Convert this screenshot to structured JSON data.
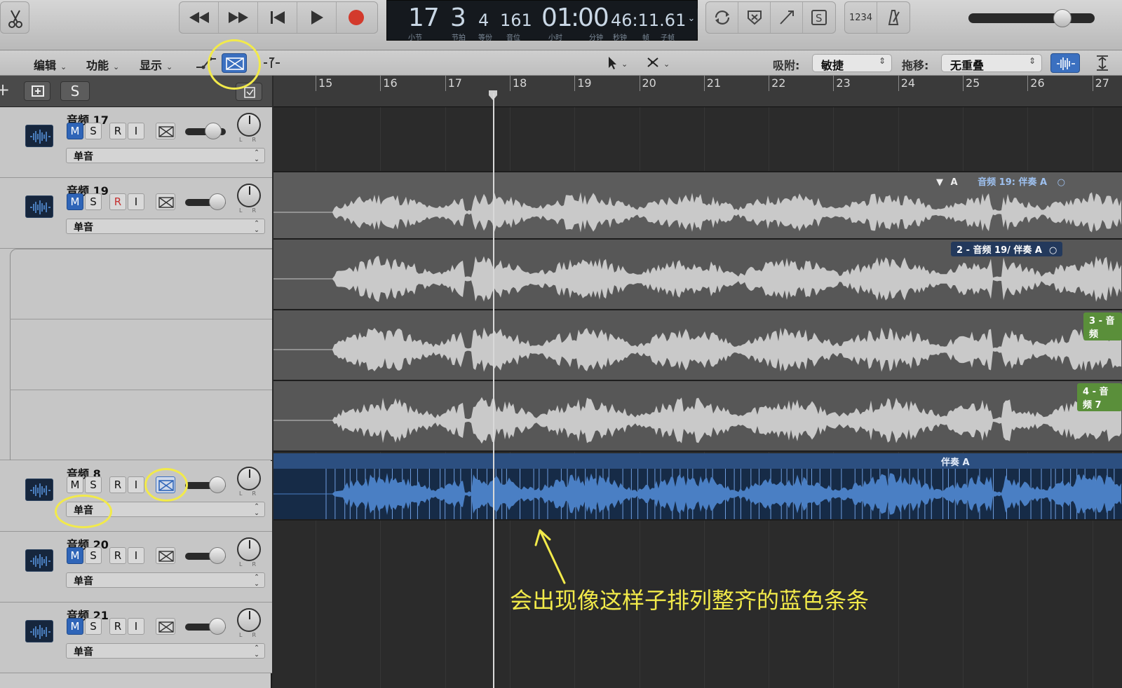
{
  "transport": {
    "buttons": [
      "rewind",
      "fast-forward",
      "go-to-start",
      "play",
      "record"
    ],
    "colors": {
      "record": "#d33a2c"
    }
  },
  "lcd": {
    "bar": "17",
    "beat": "3",
    "division": "4",
    "tick": "161",
    "hours": "01",
    "minutes_seconds": "00",
    "fine": "46:11.61",
    "labels": {
      "bar": "小节",
      "beat": "节拍",
      "division": "等份",
      "tick": "音位",
      "hours": "小时",
      "minutes": "分钟",
      "seconds": "秒钟",
      "frames": "帧",
      "subframes": "子帧"
    }
  },
  "count_in": "1234",
  "edit_menu": {
    "edit": "编辑",
    "functions": "功能",
    "view": "显示",
    "snap_label": "吸附:",
    "snap_value": "敏捷",
    "drag_label": "拖移:",
    "drag_value": "无重叠"
  },
  "track_header": {
    "solo_label": "S"
  },
  "ruler": {
    "bars": [
      "15",
      "16",
      "17",
      "18",
      "19",
      "20",
      "21",
      "22",
      "23",
      "24",
      "25",
      "26",
      "27"
    ]
  },
  "tracks": [
    {
      "name": "音频 17",
      "mode": "单音",
      "mute": true,
      "solo": false,
      "record": false
    },
    {
      "name": "音频 19",
      "mode": "单音",
      "mute": true,
      "solo": false,
      "record": true
    },
    {
      "name": "音频 8",
      "mode": "单音",
      "mute": false,
      "solo": false,
      "record": false
    },
    {
      "name": "音频 20",
      "mode": "单音",
      "mute": true,
      "solo": false,
      "record": false
    },
    {
      "name": "音频 21",
      "mode": "单音",
      "mute": true,
      "solo": false,
      "record": false
    }
  ],
  "regions": {
    "take_folder_label": "音频 19: 伴奏 A",
    "take2": "2 - 音频 19/ 伴奏 A",
    "take3": "3 - 音频",
    "take4": "4 - 音频 7",
    "flex_region": "伴奏 A",
    "take_colors": {
      "take3": "#5a8f3a",
      "take4": "#5a8f3a",
      "flex": "#2c4f80"
    }
  },
  "annotation": {
    "text": "会出现像这样子排列整齐的蓝色条条",
    "color": "#f2ea4a"
  },
  "icons": [
    "scissors-icon",
    "cycle-icon",
    "replace-icon",
    "tuner-icon",
    "solo-icon",
    "metronome-icon",
    "pointer-icon",
    "scissor-tool-icon",
    "flex-icon",
    "waveform-zoom-icon",
    "vertical-zoom-icon"
  ]
}
